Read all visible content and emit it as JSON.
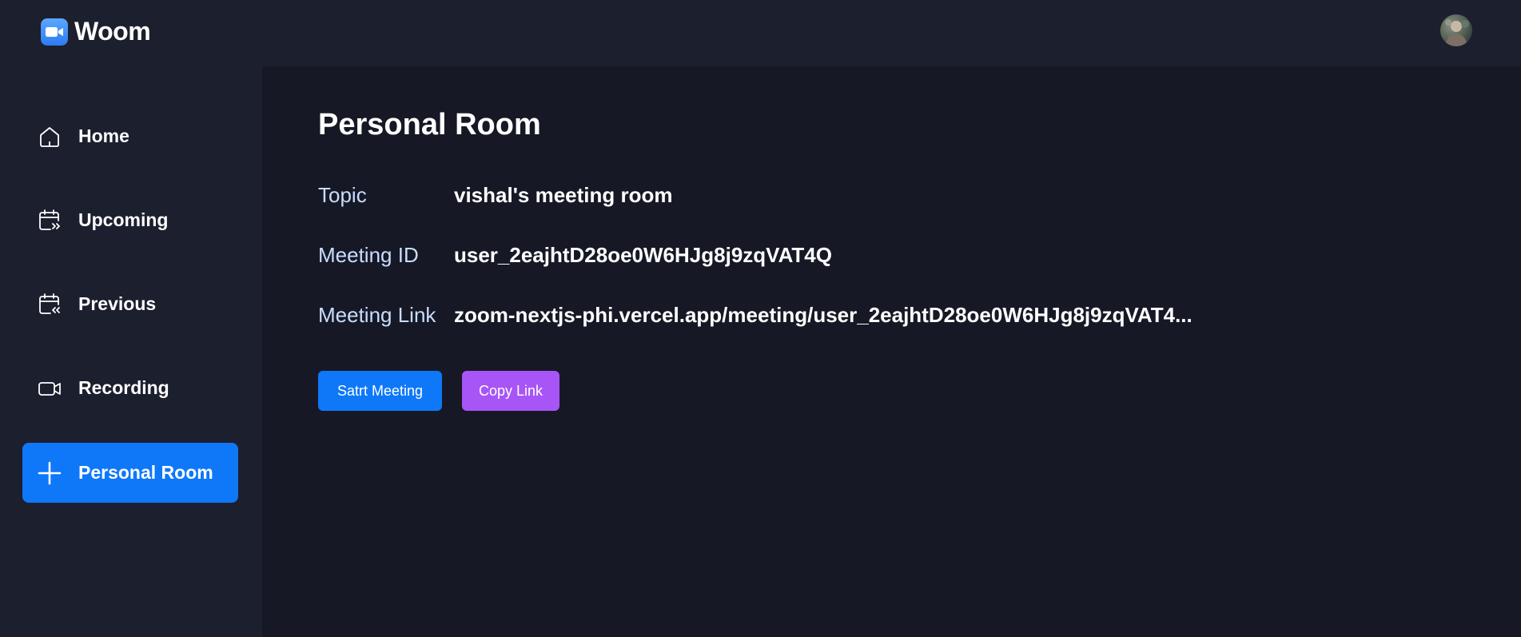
{
  "header": {
    "app_name": "Woom",
    "logo_icon": "video-camera-icon",
    "avatar_icon": "user-avatar"
  },
  "sidebar": {
    "items": [
      {
        "label": "Home",
        "icon": "home-icon",
        "active": false
      },
      {
        "label": "Upcoming",
        "icon": "calendar-upcoming-icon",
        "active": false
      },
      {
        "label": "Previous",
        "icon": "calendar-previous-icon",
        "active": false
      },
      {
        "label": "Recording",
        "icon": "video-icon",
        "active": false
      },
      {
        "label": "Personal Room",
        "icon": "plus-icon",
        "active": true
      }
    ]
  },
  "main": {
    "title": "Personal Room",
    "details": [
      {
        "label": "Topic",
        "value": "vishal's meeting room"
      },
      {
        "label": "Meeting ID",
        "value": "user_2eajhtD28oe0W6HJg8j9zqVAT4Q"
      },
      {
        "label": "Meeting Link",
        "value": "zoom-nextjs-phi.vercel.app/meeting/user_2eajhtD28oe0W6HJg8j9zqVAT4..."
      }
    ],
    "buttons": {
      "start": "Satrt Meeting",
      "copy": "Copy Link"
    }
  },
  "colors": {
    "accent_blue": "#0e78f9",
    "accent_purple": "#a855f7",
    "bg_dark": "#161925",
    "bg_panel": "#1c1f2e",
    "label_color": "#c9ddff"
  }
}
